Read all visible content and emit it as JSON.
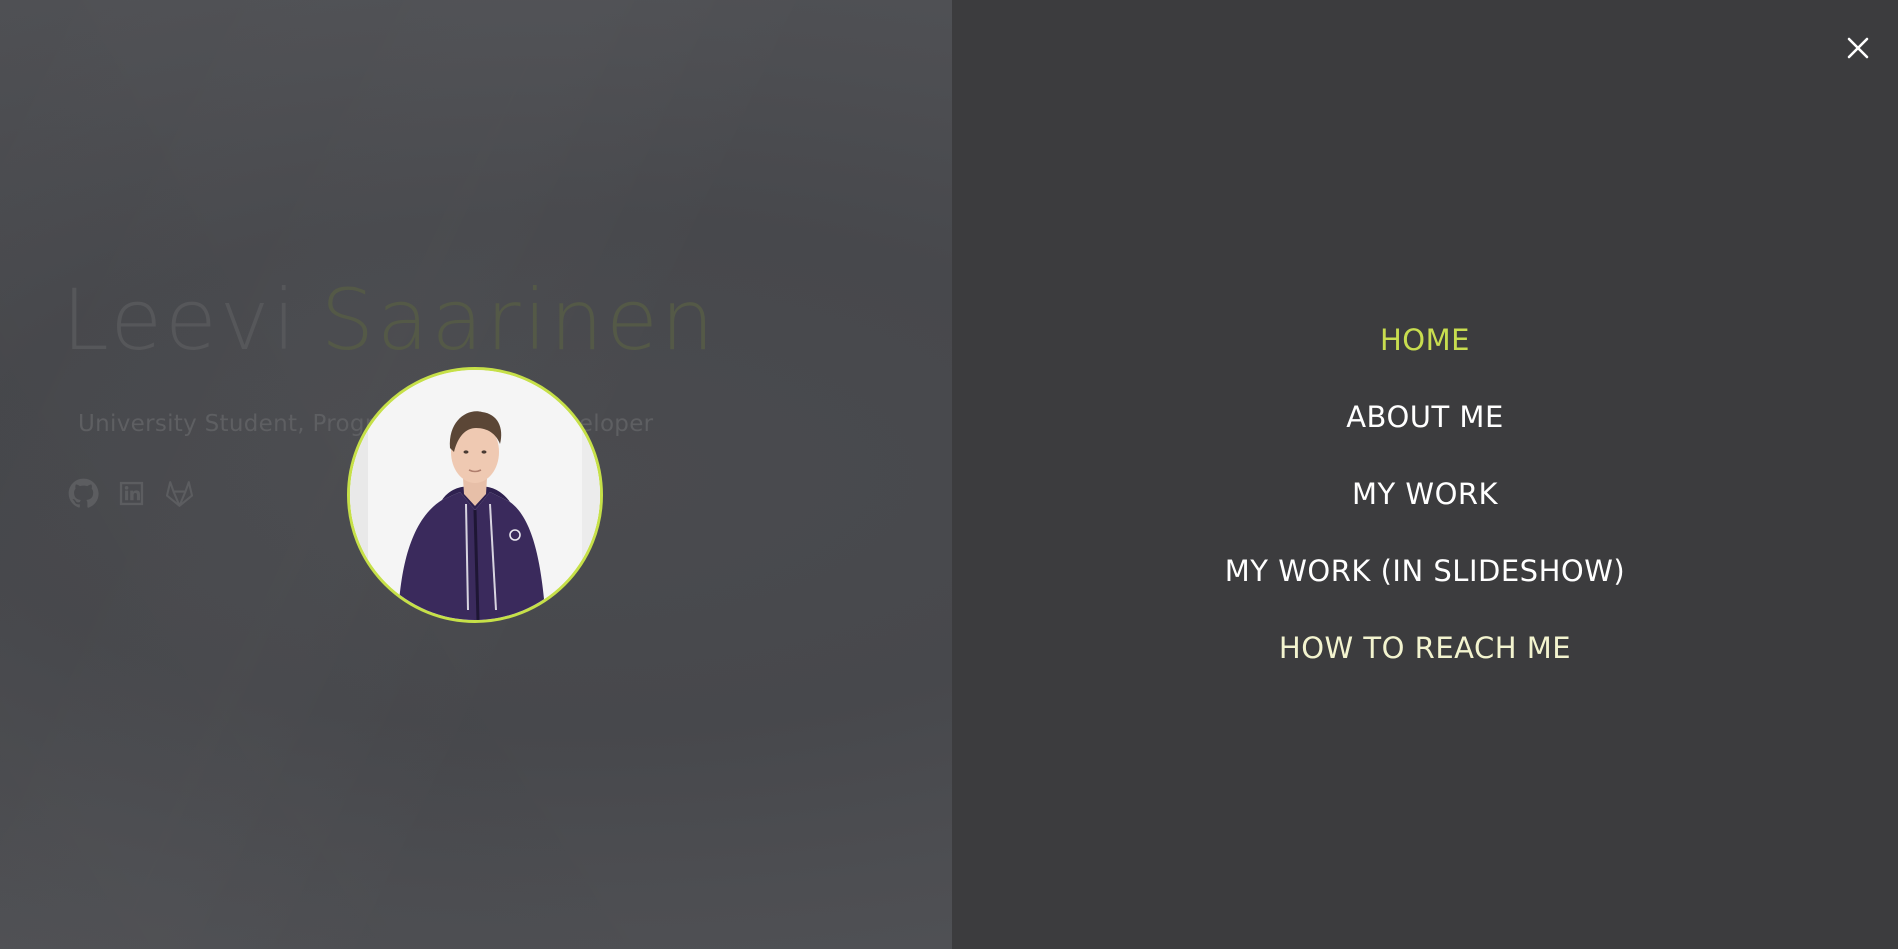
{
  "hero": {
    "first_name": "Leevi",
    "last_name": "Saarinen",
    "subtitle": "University Student, Programmer, Web Developer"
  },
  "social": [
    {
      "icon": "github-icon",
      "label": "GitHub"
    },
    {
      "icon": "linkedin-icon",
      "label": "LinkedIn"
    },
    {
      "icon": "gitlab-icon",
      "label": "GitLab"
    }
  ],
  "nav": {
    "items": [
      {
        "label": "HOME",
        "state": "active"
      },
      {
        "label": "ABOUT ME",
        "state": "default"
      },
      {
        "label": "MY WORK",
        "state": "default"
      },
      {
        "label": "MY WORK (IN SLIDESHOW)",
        "state": "default"
      },
      {
        "label": "HOW TO REACH ME",
        "state": "hover"
      }
    ],
    "close_icon": "close-icon"
  },
  "colors": {
    "accent": "#c8dd4f",
    "panel_bg": "#3c3c3e",
    "page_bg": "#4a4b4f",
    "avatar_border": "#c6e048"
  }
}
